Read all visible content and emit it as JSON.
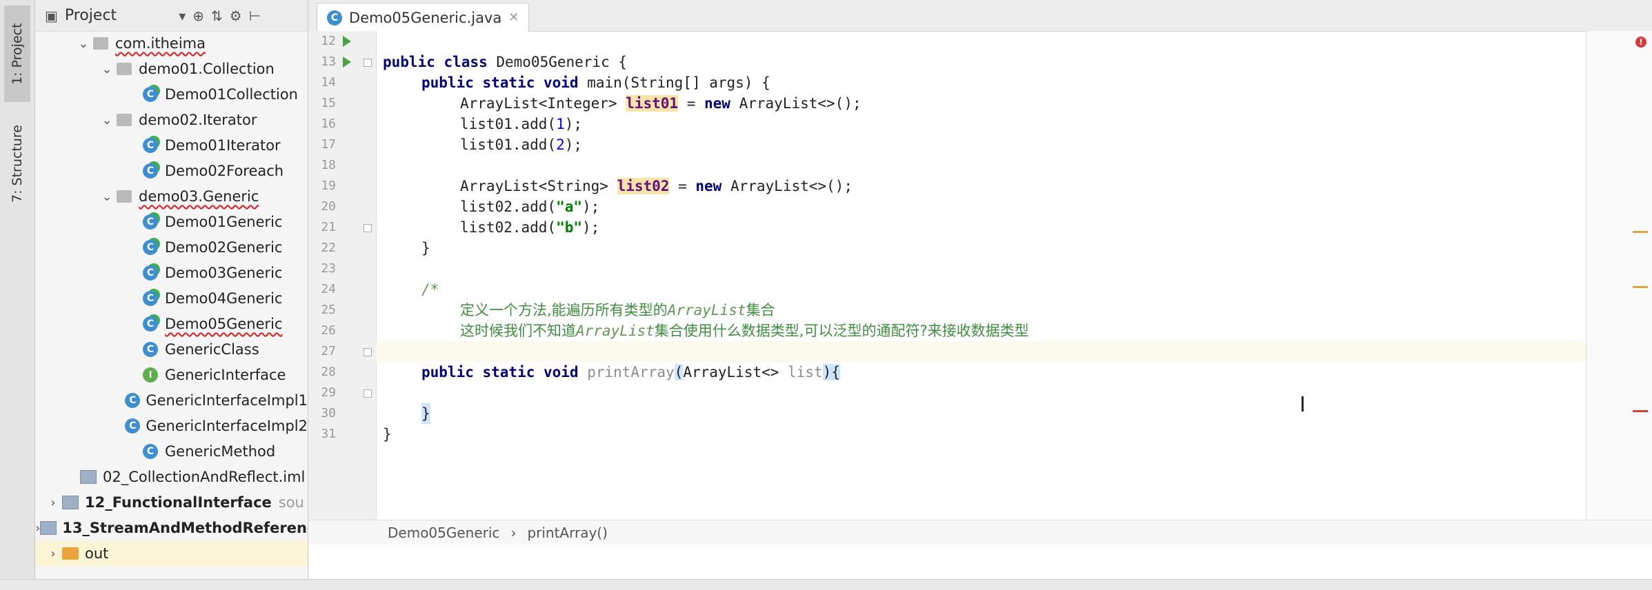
{
  "sidebar_tabs": {
    "project": "1: Project",
    "structure": "7: Structure"
  },
  "project_panel": {
    "title": "Project",
    "tree": [
      {
        "label": "com.itheima",
        "kind": "package",
        "arrow": "⌄",
        "depth": 0,
        "squiggle": true
      },
      {
        "label": "demo01.Collection",
        "kind": "package",
        "arrow": "⌄",
        "depth": 1
      },
      {
        "label": "Demo01Collection",
        "kind": "class-run",
        "arrow": "",
        "depth": 2
      },
      {
        "label": "demo02.Iterator",
        "kind": "package",
        "arrow": "⌄",
        "depth": 1
      },
      {
        "label": "Demo01Iterator",
        "kind": "class-run",
        "arrow": "",
        "depth": 2
      },
      {
        "label": "Demo02Foreach",
        "kind": "class-run",
        "arrow": "",
        "depth": 2
      },
      {
        "label": "demo03.Generic",
        "kind": "package",
        "arrow": "⌄",
        "depth": 1,
        "squiggle": true
      },
      {
        "label": "Demo01Generic",
        "kind": "class-run",
        "arrow": "",
        "depth": 2
      },
      {
        "label": "Demo02Generic",
        "kind": "class-run",
        "arrow": "",
        "depth": 2
      },
      {
        "label": "Demo03Generic",
        "kind": "class-run",
        "arrow": "",
        "depth": 2
      },
      {
        "label": "Demo04Generic",
        "kind": "class-run",
        "arrow": "",
        "depth": 2
      },
      {
        "label": "Demo05Generic",
        "kind": "class-run",
        "arrow": "",
        "depth": 2,
        "squiggle": true
      },
      {
        "label": "GenericClass",
        "kind": "class",
        "arrow": "",
        "depth": 2
      },
      {
        "label": "GenericInterface",
        "kind": "interface",
        "arrow": "",
        "depth": 2
      },
      {
        "label": "GenericInterfaceImpl1",
        "kind": "class",
        "arrow": "",
        "depth": 2
      },
      {
        "label": "GenericInterfaceImpl2",
        "kind": "class",
        "arrow": "",
        "depth": 2
      },
      {
        "label": "GenericMethod",
        "kind": "class",
        "arrow": "",
        "depth": 2
      },
      {
        "label": "02_CollectionAndReflect.iml",
        "kind": "iml",
        "arrow": "",
        "depth": -1
      },
      {
        "label": "12_FunctionalInterface",
        "kind": "module",
        "arrow": "›",
        "depth": -2,
        "bold": true,
        "suffix": "sou"
      },
      {
        "label": "13_StreamAndMethodReference",
        "kind": "module",
        "arrow": "›",
        "depth": -2,
        "bold": true
      },
      {
        "label": "out",
        "kind": "folder",
        "arrow": "›",
        "depth": -2,
        "selected": true
      }
    ]
  },
  "editor": {
    "tab_label": "Demo05Generic.java",
    "breadcrumb": [
      "Demo05Generic",
      "printArray()"
    ],
    "line_numbers": [
      "12",
      "13",
      "14",
      "15",
      "16",
      "17",
      "18",
      "19",
      "20",
      "21",
      "22",
      "23",
      "24",
      "25",
      "26",
      "27",
      "28",
      "29",
      "30",
      "31"
    ],
    "code": {
      "l12_a": "public class",
      "l12_b": " Demo05Generic {",
      "l13_a": "public static void",
      "l13_b": " main(String[] args) {",
      "l14_a": "ArrayList<Integer> ",
      "l14_var": "list01",
      "l14_b": " = ",
      "l14_new": "new",
      "l14_c": " ArrayList<>();",
      "l15_a": "list01.add(",
      "l15_n": "1",
      "l15_b": ");",
      "l16_a": "list01.add(",
      "l16_n": "2",
      "l16_b": ");",
      "l18_a": "ArrayList<String> ",
      "l18_var": "list02",
      "l18_b": " = ",
      "l18_new": "new",
      "l18_c": " ArrayList<>();",
      "l19_a": "list02.add(",
      "l19_s": "\"a\"",
      "l19_b": ");",
      "l20_a": "list02.add(",
      "l20_s": "\"b\"",
      "l20_b": ");",
      "l21": "}",
      "l23": "/*",
      "l24_a": "定义一个方法,能遍历所有类型的",
      "l24_i": "ArrayList",
      "l24_b": "集合",
      "l25_a": "这时候我们不知道",
      "l25_i": "ArrayList",
      "l25_b": "集合使用什么数据类型,可以泛型的通配符?来接收数据类型",
      "l26": "*/",
      "l27_a": "public static void",
      "l27_m": " printArray",
      "l27_p1": "(",
      "l27_t": "ArrayList<>",
      "l27_v": " list",
      "l27_p2": ")",
      "l27_b": "{",
      "l29": "}",
      "l30": "}"
    }
  }
}
